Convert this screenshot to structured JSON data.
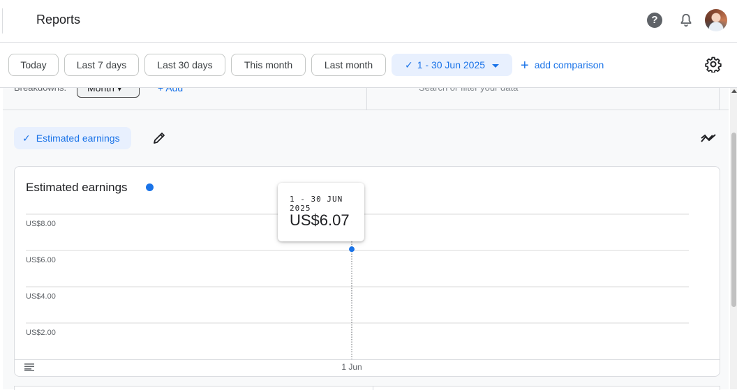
{
  "header": {
    "title": "Reports",
    "help_icon": "help-icon",
    "notification_icon": "bell-icon",
    "avatar": "user-avatar"
  },
  "filters": {
    "chips": [
      {
        "label": "Today"
      },
      {
        "label": "Last 7 days"
      },
      {
        "label": "Last 30 days"
      },
      {
        "label": "This month"
      },
      {
        "label": "Last month"
      }
    ],
    "selected_range": "1 - 30 Jun 2025",
    "add_comparison": "add comparison",
    "settings_icon": "gear-icon"
  },
  "breakdown": {
    "label": "Breakdowns:",
    "value": "Month",
    "add_label": "Add",
    "search_placeholder": "Search or filter your data"
  },
  "metric": {
    "chip_label": "Estimated earnings",
    "edit_icon": "pencil-icon",
    "trend_icon": "trend-icon"
  },
  "colors": {
    "accent": "#1a73e8",
    "chip_bg": "#e8f0fe",
    "border": "#dadce0",
    "panel_bg": "#f8f9fa"
  },
  "chart_data": {
    "type": "line",
    "title": "Estimated earnings",
    "categories": [
      "1 Jun"
    ],
    "series": [
      {
        "name": "Estimated earnings",
        "values": [
          6.07
        ]
      }
    ],
    "ylim": [
      0,
      10
    ],
    "yticks": [
      {
        "value": 2,
        "label": "US$2.00"
      },
      {
        "value": 4,
        "label": "US$4.00"
      },
      {
        "value": 6,
        "label": "US$6.00"
      },
      {
        "value": 8,
        "label": "US$8.00"
      }
    ],
    "xlabel": "",
    "ylabel": "",
    "grid": true
  },
  "tooltip": {
    "date": "1 - 30 JUN 2025",
    "value": "US$6.07"
  }
}
